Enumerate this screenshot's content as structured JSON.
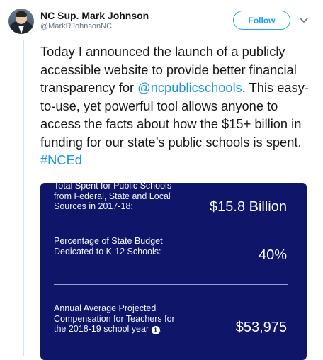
{
  "tweet": {
    "author_name": "NC Sup. Mark Johnson",
    "author_handle": "@MarkRJohnsonNC",
    "follow_label": "Follow",
    "text_part1": "Today I announced the launch of a publicly accessible website to provide better financial transparency for ",
    "mention": "@ncpublicschools",
    "text_part2": ". This easy-to-use, yet powerful tool allows anyone to access the facts about how the $15+ billion in funding for our state’s public schools is spent. ",
    "hashtag": "#NCEd"
  },
  "card": {
    "rows": [
      {
        "label": "Total Spent for Public Schools from Federal, State and Local Sources in 2017-18:",
        "value": "$15.8 Billion"
      },
      {
        "label": "Percentage of State Budget Dedicated to K-12 Schools:",
        "value": "40%"
      },
      {
        "label": "Annual Average Projected Compensation for Teachers for the 2018-19 school year",
        "value": "$53,975",
        "label_suffix": ":"
      }
    ]
  },
  "colors": {
    "accent": "#1da1f2",
    "card_bg": "#0f1569"
  },
  "icons": {
    "avatar": "profile-photo",
    "menu": "chevron-down-icon",
    "info": "info-icon"
  }
}
